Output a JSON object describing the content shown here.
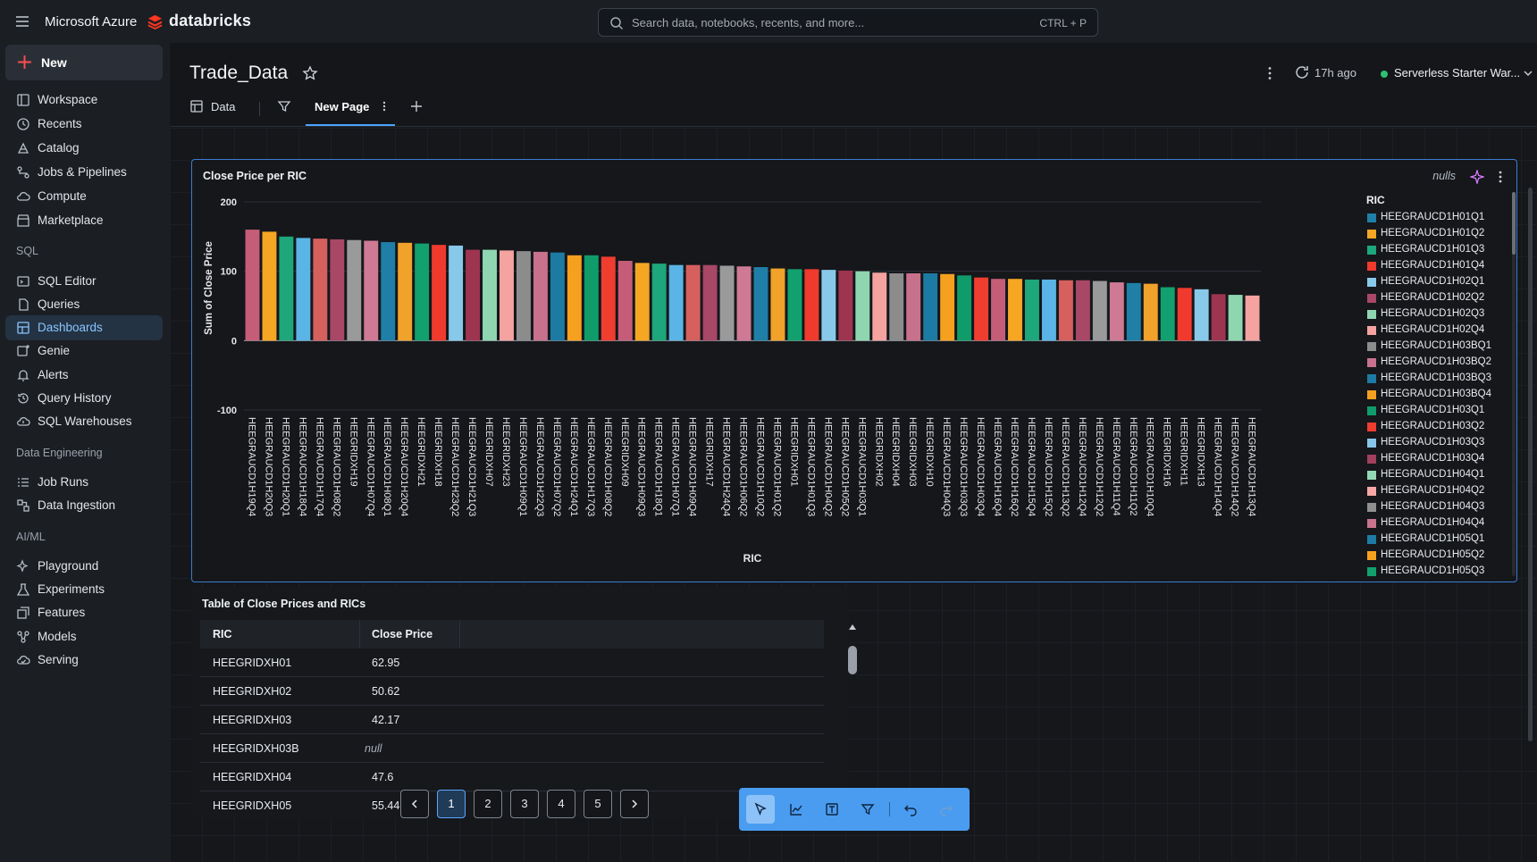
{
  "topbar": {
    "brand_azure": "Microsoft Azure",
    "brand_product": "databricks",
    "search_placeholder": "Search data, notebooks, recents, and more...",
    "search_shortcut": "CTRL + P"
  },
  "sidebar": {
    "new_label": "New",
    "items": [
      {
        "label": "Workspace",
        "icon": "workspace-icon"
      },
      {
        "label": "Recents",
        "icon": "clock-icon"
      },
      {
        "label": "Catalog",
        "icon": "catalog-icon"
      },
      {
        "label": "Jobs & Pipelines",
        "icon": "workflow-icon"
      },
      {
        "label": "Compute",
        "icon": "cloud-icon"
      },
      {
        "label": "Marketplace",
        "icon": "store-icon"
      }
    ],
    "sql_section": "SQL",
    "sql_items": [
      {
        "label": "SQL Editor",
        "icon": "sql-editor-icon"
      },
      {
        "label": "Queries",
        "icon": "file-icon"
      },
      {
        "label": "Dashboards",
        "icon": "dashboard-icon",
        "active": true
      },
      {
        "label": "Genie",
        "icon": "genie-icon"
      },
      {
        "label": "Alerts",
        "icon": "bell-icon"
      },
      {
        "label": "Query History",
        "icon": "history-icon"
      },
      {
        "label": "SQL Warehouses",
        "icon": "warehouse-icon"
      }
    ],
    "de_section": "Data Engineering",
    "de_items": [
      {
        "label": "Job Runs",
        "icon": "list-icon"
      },
      {
        "label": "Data Ingestion",
        "icon": "ingestion-icon"
      }
    ],
    "ml_section": "AI/ML",
    "ml_items": [
      {
        "label": "Playground",
        "icon": "sparkles-icon"
      },
      {
        "label": "Experiments",
        "icon": "flask-icon"
      },
      {
        "label": "Features",
        "icon": "features-icon"
      },
      {
        "label": "Models",
        "icon": "models-icon"
      },
      {
        "label": "Serving",
        "icon": "serving-icon"
      }
    ]
  },
  "header": {
    "title": "Trade_Data",
    "refreshed": "17h ago",
    "warehouse": "Serverless Starter War..."
  },
  "tabs": {
    "data": "Data",
    "page": "New Page"
  },
  "chart_widget": {
    "title": "Close Price per RIC",
    "nulls_label": "nulls"
  },
  "chart_data": {
    "type": "bar",
    "title": "Close Price per RIC",
    "xlabel": "RIC",
    "ylabel": "Sum of Close Price",
    "ylim": [
      -100,
      200
    ],
    "yticks": [
      -100,
      0,
      100,
      200
    ],
    "grid": true,
    "legend_title": "RIC",
    "legend_placement": "right",
    "categories": [
      "HEEGRAUCD1H19Q4",
      "HEEGRAUCD1H20Q3",
      "HEEGRAUCD1H20Q1",
      "HEEGRAUCD1H18Q4",
      "HEEGRAUCD1H17Q4",
      "HEEGRAUCD1H08Q2",
      "HEEGRIDXH19",
      "HEEGRAUCD1H07Q4",
      "HEEGRAUCD1H08Q1",
      "HEEGRAUCD1H20Q4",
      "HEEGRIDXH21",
      "HEEGRIDXH18",
      "HEEGRAUCD1H23Q2",
      "HEEGRAUCD1H21Q3",
      "HEEGRIDXH07",
      "HEEGRIDXH23",
      "HEEGRAUCD1H09Q1",
      "HEEGRAUCD1H22Q3",
      "HEEGRAUCD1H07Q2",
      "HEEGRAUCD1H24Q1",
      "HEEGRAUCD1H17Q3",
      "HEEGRAUCD1H08Q2",
      "HEEGRIDXH09",
      "HEEGRAUCD1H09Q3",
      "HEEGRAUCD1H18Q1",
      "HEEGRAUCD1H07Q1",
      "HEEGRAUCD1H09Q4",
      "HEEGRIDXH17",
      "HEEGRAUCD1H24Q4",
      "HEEGRAUCD1H06Q2",
      "HEEGRAUCD1H10Q2",
      "HEEGRAUCD1H01Q2",
      "HEEGRIDXH01",
      "HEEGRAUCD1H01Q3",
      "HEEGRAUCD1H04Q2",
      "HEEGRAUCD1H05Q2",
      "HEEGRAUCD1H03Q1",
      "HEEGRIDXH02",
      "HEEGRIDXH04",
      "HEEGRIDXH03",
      "HEEGRIDXH10",
      "HEEGRAUCD1H04Q3",
      "HEEGRAUCD1H03Q3",
      "HEEGRAUCD1H03Q4",
      "HEEGRAUCD1H16Q4",
      "HEEGRAUCD1H16Q2",
      "HEEGRAUCD1H15Q4",
      "HEEGRAUCD1H15Q2",
      "HEEGRAUCD1H13Q2",
      "HEEGRAUCD1H12Q4",
      "HEEGRAUCD1H12Q2",
      "HEEGRAUCD1H11Q4",
      "HEEGRAUCD1H11Q2",
      "HEEGRAUCD1H10Q4",
      "HEEGRIDXH16",
      "HEEGRIDXH11",
      "HEEGRIDXH13",
      "HEEGRAUCD1H14Q4",
      "HEEGRAUCD1H14Q2",
      "HEEGRAUCD1H13Q4"
    ],
    "values": [
      160,
      157,
      150,
      148,
      147,
      146,
      145,
      144,
      142,
      141,
      140,
      138,
      137,
      131,
      131,
      130,
      129,
      128,
      127,
      123,
      123,
      121,
      115,
      112,
      111,
      109,
      109,
      109,
      108,
      107,
      106,
      104,
      103,
      103,
      102,
      101,
      100,
      98,
      97,
      97,
      97,
      96,
      94,
      91,
      89,
      89,
      88,
      88,
      87,
      87,
      86,
      84,
      83,
      82,
      77,
      76,
      74,
      67,
      66,
      65
    ],
    "series_colors": [
      "#c65d78",
      "#f5a623",
      "#1da77a",
      "#5ab4e5",
      "#d6605e",
      "#a84766",
      "#9a9a9a",
      "#cf7a94",
      "#1f7fa6",
      "#f0a22a",
      "#11a06e",
      "#f03a2e",
      "#88c9ea",
      "#9e3550",
      "#8fd6b0",
      "#f4a3a0",
      "#8c8c8c",
      "#c8718c",
      "#1d7aa2",
      "#f6a020",
      "#0f9c6a",
      "#ef3d30"
    ]
  },
  "legend": [
    {
      "label": "HEEGRAUCD1H01Q1",
      "color": "#1f7fa6"
    },
    {
      "label": "HEEGRAUCD1H01Q2",
      "color": "#f5a623"
    },
    {
      "label": "HEEGRAUCD1H01Q3",
      "color": "#1da77a"
    },
    {
      "label": "HEEGRAUCD1H01Q4",
      "color": "#f03a2e"
    },
    {
      "label": "HEEGRAUCD1H02Q1",
      "color": "#88c9ea"
    },
    {
      "label": "HEEGRAUCD1H02Q2",
      "color": "#a84766"
    },
    {
      "label": "HEEGRAUCD1H02Q3",
      "color": "#8fd6b0"
    },
    {
      "label": "HEEGRAUCD1H02Q4",
      "color": "#f4a3a0"
    },
    {
      "label": "HEEGRAUCD1H03BQ1",
      "color": "#8c8c8c"
    },
    {
      "label": "HEEGRAUCD1H03BQ2",
      "color": "#c8718c"
    },
    {
      "label": "HEEGRAUCD1H03BQ3",
      "color": "#1d7aa2"
    },
    {
      "label": "HEEGRAUCD1H03BQ4",
      "color": "#f6a020"
    },
    {
      "label": "HEEGRAUCD1H03Q1",
      "color": "#0f9c6a"
    },
    {
      "label": "HEEGRAUCD1H03Q2",
      "color": "#ef3d30"
    },
    {
      "label": "HEEGRAUCD1H03Q3",
      "color": "#86c6e8"
    },
    {
      "label": "HEEGRAUCD1H03Q4",
      "color": "#a23f5c"
    },
    {
      "label": "HEEGRAUCD1H04Q1",
      "color": "#92d8b4"
    },
    {
      "label": "HEEGRAUCD1H04Q2",
      "color": "#f5a8a4"
    },
    {
      "label": "HEEGRAUCD1H04Q3",
      "color": "#909090"
    },
    {
      "label": "HEEGRAUCD1H04Q4",
      "color": "#c9738d"
    },
    {
      "label": "HEEGRAUCD1H05Q1",
      "color": "#1e7ca4"
    },
    {
      "label": "HEEGRAUCD1H05Q2",
      "color": "#f7a21c"
    },
    {
      "label": "HEEGRAUCD1H05Q3",
      "color": "#12a06d"
    }
  ],
  "table_widget": {
    "title": "Table of Close Prices and RICs",
    "columns": [
      "RIC",
      "Close Price"
    ],
    "rows": [
      [
        "HEEGRIDXH01",
        "62.95"
      ],
      [
        "HEEGRIDXH02",
        "50.62"
      ],
      [
        "HEEGRIDXH03",
        "42.17"
      ],
      [
        "HEEGRIDXH03B",
        "null"
      ],
      [
        "HEEGRIDXH04",
        "47.6"
      ],
      [
        "HEEGRIDXH05",
        "55.44"
      ]
    ],
    "pages": [
      "1",
      "2",
      "3",
      "4",
      "5"
    ],
    "current_page": "1"
  },
  "toolbar": {
    "tools": [
      "select-icon",
      "chart-icon",
      "textbox-icon",
      "filter-icon",
      "undo-icon",
      "redo-icon"
    ]
  }
}
